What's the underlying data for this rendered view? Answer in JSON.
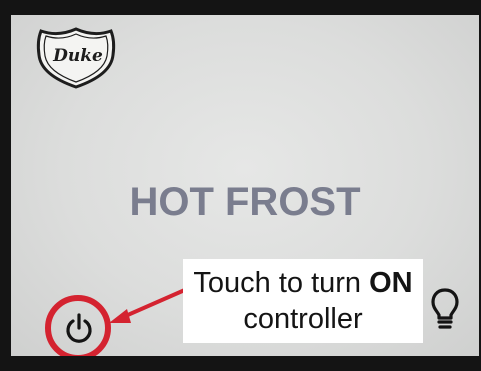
{
  "brand": {
    "name": "Duke"
  },
  "screen": {
    "title": "HOT FROST"
  },
  "callout": {
    "line1_prefix": "Touch to turn ",
    "line1_bold": "ON",
    "line2": "controller"
  },
  "icons": {
    "power": "power-icon",
    "light": "lightbulb-icon",
    "logo": "duke-shield-logo"
  },
  "colors": {
    "highlight_red": "#d42330",
    "title_gray": "#7a7d8e",
    "screen_bg": "#dcdddc"
  }
}
